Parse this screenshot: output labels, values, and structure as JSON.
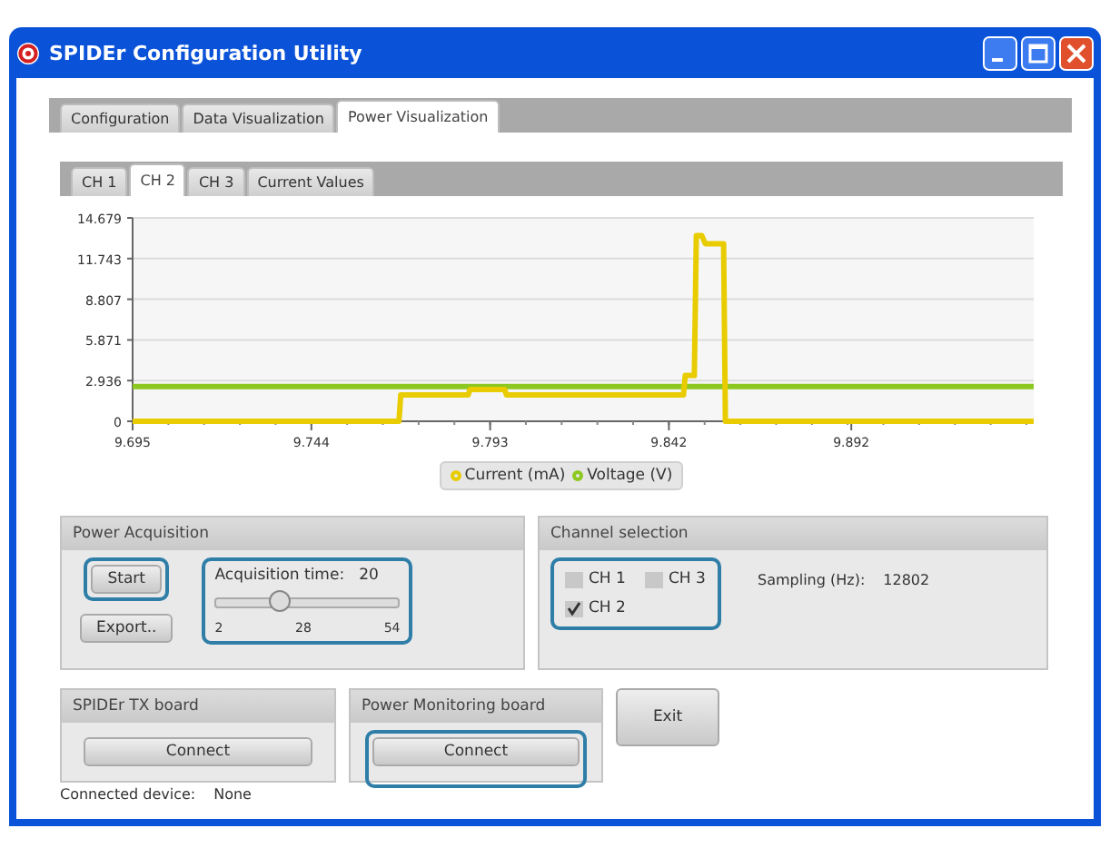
{
  "window": {
    "title": "SPIDEr Configuration Utility"
  },
  "tabs": [
    {
      "label": "Configuration",
      "selected": false
    },
    {
      "label": "Data Visualization",
      "selected": false
    },
    {
      "label": "Power Visualization",
      "selected": true
    }
  ],
  "channel_tabs": [
    {
      "label": "CH 1",
      "selected": false
    },
    {
      "label": "CH 2",
      "selected": true
    },
    {
      "label": "CH 3",
      "selected": false
    },
    {
      "label": "Current Values",
      "selected": false
    }
  ],
  "chart": {
    "chart_data": {
      "type": "line",
      "x": [
        9.695,
        9.768,
        9.7685,
        9.787,
        9.7875,
        9.797,
        9.7975,
        9.846,
        9.8465,
        9.849,
        9.8495,
        9.851,
        9.852,
        9.857,
        9.8575,
        9.942
      ],
      "series": [
        {
          "name": "Current (mA)",
          "color": "#e8cc00",
          "values": [
            0,
            0,
            1.9,
            1.9,
            2.3,
            2.3,
            1.9,
            1.9,
            3.3,
            3.3,
            13.4,
            13.4,
            12.8,
            12.8,
            0,
            0
          ]
        },
        {
          "name": "Voltage (V)",
          "color": "#8cc820",
          "values": [
            2.5,
            2.5,
            2.5,
            2.5,
            2.5,
            2.5,
            2.5,
            2.5,
            2.5,
            2.5,
            2.5,
            2.5,
            2.5,
            2.5,
            2.5,
            2.5
          ]
        }
      ],
      "xlim": [
        9.695,
        9.942
      ],
      "ylim": [
        0,
        14.679
      ],
      "xticks": [
        9.695,
        9.744,
        9.793,
        9.842,
        9.892
      ],
      "yticks": [
        0,
        2.936,
        5.871,
        8.807,
        11.743,
        14.679
      ],
      "grid": true
    }
  },
  "power_acquisition": {
    "title": "Power Acquisition",
    "buttons": [
      {
        "label": "Start",
        "highlighted": true
      },
      {
        "label": "Export..",
        "highlighted": false
      }
    ],
    "acquisition_time": {
      "label": "Acquisition time:",
      "value": "20",
      "level": 0.35,
      "ticks": [
        "2",
        "28",
        "54"
      ],
      "highlighted": true
    }
  },
  "channel_selection": {
    "title": "Channel selection",
    "highlighted": true,
    "channels": [
      {
        "label": "CH 1",
        "checked": false
      },
      {
        "label": "CH 3",
        "checked": false
      },
      {
        "label": "CH 2",
        "checked": true
      }
    ],
    "sampling_label": "Sampling (Hz):",
    "sampling_value": "12802"
  },
  "boards": [
    {
      "title": "SPIDEr TX board",
      "button": "Connect",
      "highlighted": false
    },
    {
      "title": "Power Monitoring board",
      "button": "Connect",
      "highlighted": true
    }
  ],
  "exit_button": "Exit",
  "status": {
    "label": "Connected device:",
    "value": "None"
  }
}
